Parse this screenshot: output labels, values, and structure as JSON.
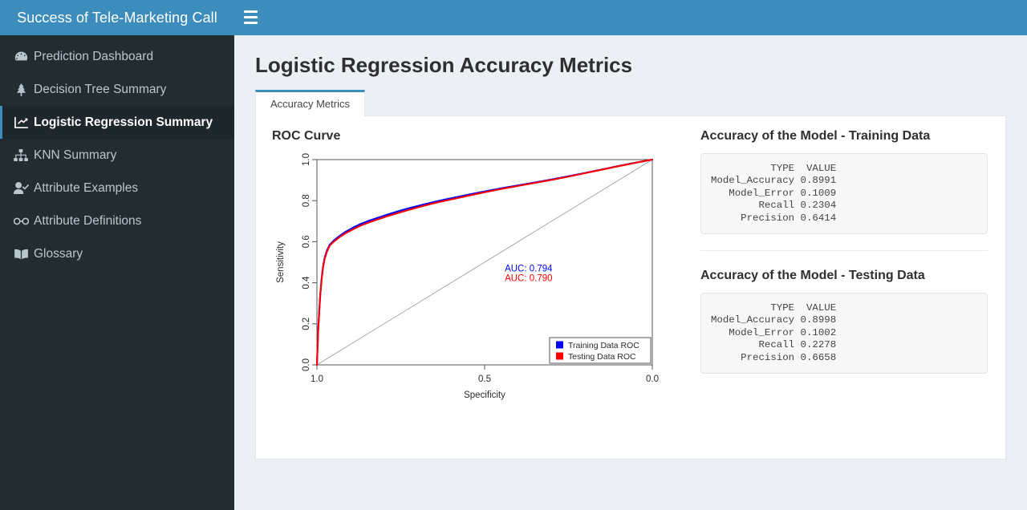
{
  "brand": {
    "title": "Success of Tele-Marketing Call"
  },
  "topbar": {
    "menu_icon": "hamburger-icon"
  },
  "sidebar": {
    "items": [
      {
        "label": "Prediction Dashboard",
        "icon": "tachometer-icon",
        "active": false
      },
      {
        "label": "Decision Tree Summary",
        "icon": "tree-icon",
        "active": false
      },
      {
        "label": "Logistic Regression Summary",
        "icon": "chart-line-icon",
        "active": true
      },
      {
        "label": "KNN Summary",
        "icon": "sitemap-icon",
        "active": false
      },
      {
        "label": "Attribute Examples",
        "icon": "user-check-icon",
        "active": false
      },
      {
        "label": "Attribute Definitions",
        "icon": "glasses-icon",
        "active": false
      },
      {
        "label": "Glossary",
        "icon": "book-icon",
        "active": false
      }
    ]
  },
  "page": {
    "title": "Logistic Regression Accuracy Metrics"
  },
  "tabs": [
    {
      "label": "Accuracy Metrics",
      "active": true
    }
  ],
  "plot_panel": {
    "title": "ROC Curve"
  },
  "training": {
    "title": "Accuracy of the Model - Training Data",
    "text": "          TYPE  VALUE\nModel_Accuracy 0.8991\n   Model_Error 0.1009\n        Recall 0.2304\n     Precision 0.6414"
  },
  "testing": {
    "title": "Accuracy of the Model - Testing Data",
    "text": "          TYPE  VALUE\nModel_Accuracy 0.8998\n   Model_Error 0.1002\n        Recall 0.2278\n     Precision 0.6658"
  },
  "colors": {
    "brand_blue": "#3c8dbc",
    "sidebar_dark": "#222d32",
    "page_bg": "#ecf0f5",
    "training_roc": "#0000ff",
    "testing_roc": "#ff0000",
    "diagonal": "#999999"
  },
  "chart_data": {
    "type": "line",
    "title": "ROC Curve",
    "xlabel": "Specificity",
    "ylabel": "Sensitivity",
    "xlim": [
      1.0,
      0.0
    ],
    "ylim": [
      0.0,
      1.0
    ],
    "x_ticks": [
      "1.0",
      "0.5",
      "0.0"
    ],
    "x_tick_values": [
      1.0,
      0.5,
      0.0
    ],
    "y_ticks": [
      "0.0",
      "0.2",
      "0.4",
      "0.6",
      "0.8",
      "1.0"
    ],
    "y_tick_values": [
      0.0,
      0.2,
      0.4,
      0.6,
      0.8,
      1.0
    ],
    "grid": false,
    "x_axis_reversed": true,
    "legend_position": "bottom-right",
    "annotations": [
      {
        "text": "AUC: 0.794",
        "color": "#0000ff",
        "x": 0.44,
        "y": 0.455
      },
      {
        "text": "AUC: 0.790",
        "color": "#ff0000",
        "x": 0.44,
        "y": 0.408
      }
    ],
    "series": [
      {
        "name": "Training Data ROC",
        "color": "#0000ff",
        "auc": 0.794,
        "points": [
          [
            1.0,
            0.0
          ],
          [
            0.998,
            0.09
          ],
          [
            0.996,
            0.175
          ],
          [
            0.993,
            0.265
          ],
          [
            0.99,
            0.345
          ],
          [
            0.986,
            0.42
          ],
          [
            0.982,
            0.478
          ],
          [
            0.977,
            0.522
          ],
          [
            0.97,
            0.558
          ],
          [
            0.962,
            0.585
          ],
          [
            0.95,
            0.605
          ],
          [
            0.935,
            0.625
          ],
          [
            0.915,
            0.648
          ],
          [
            0.893,
            0.668
          ],
          [
            0.87,
            0.686
          ],
          [
            0.845,
            0.702
          ],
          [
            0.818,
            0.717
          ],
          [
            0.79,
            0.732
          ],
          [
            0.76,
            0.747
          ],
          [
            0.728,
            0.762
          ],
          [
            0.695,
            0.776
          ],
          [
            0.66,
            0.79
          ],
          [
            0.622,
            0.804
          ],
          [
            0.582,
            0.818
          ],
          [
            0.54,
            0.832
          ],
          [
            0.496,
            0.846
          ],
          [
            0.45,
            0.86
          ],
          [
            0.402,
            0.874
          ],
          [
            0.352,
            0.888
          ],
          [
            0.3,
            0.903
          ],
          [
            0.25,
            0.919
          ],
          [
            0.2,
            0.935
          ],
          [
            0.15,
            0.952
          ],
          [
            0.1,
            0.969
          ],
          [
            0.06,
            0.982
          ],
          [
            0.03,
            0.991
          ],
          [
            0.01,
            0.997
          ],
          [
            0.0,
            1.0
          ]
        ]
      },
      {
        "name": "Testing Data ROC",
        "color": "#ff0000",
        "auc": 0.79,
        "points": [
          [
            1.0,
            0.0
          ],
          [
            0.998,
            0.088
          ],
          [
            0.996,
            0.172
          ],
          [
            0.993,
            0.26
          ],
          [
            0.99,
            0.34
          ],
          [
            0.986,
            0.414
          ],
          [
            0.982,
            0.472
          ],
          [
            0.977,
            0.516
          ],
          [
            0.97,
            0.552
          ],
          [
            0.962,
            0.58
          ],
          [
            0.95,
            0.6
          ],
          [
            0.935,
            0.619
          ],
          [
            0.915,
            0.641
          ],
          [
            0.893,
            0.66
          ],
          [
            0.87,
            0.678
          ],
          [
            0.845,
            0.694
          ],
          [
            0.818,
            0.709
          ],
          [
            0.79,
            0.724
          ],
          [
            0.76,
            0.739
          ],
          [
            0.728,
            0.754
          ],
          [
            0.695,
            0.769
          ],
          [
            0.66,
            0.784
          ],
          [
            0.622,
            0.798
          ],
          [
            0.582,
            0.812
          ],
          [
            0.54,
            0.827
          ],
          [
            0.496,
            0.842
          ],
          [
            0.45,
            0.857
          ],
          [
            0.402,
            0.871
          ],
          [
            0.352,
            0.886
          ],
          [
            0.3,
            0.901
          ],
          [
            0.25,
            0.917
          ],
          [
            0.2,
            0.934
          ],
          [
            0.15,
            0.951
          ],
          [
            0.1,
            0.968
          ],
          [
            0.06,
            0.981
          ],
          [
            0.03,
            0.991
          ],
          [
            0.01,
            0.997
          ],
          [
            0.0,
            1.0
          ]
        ]
      }
    ],
    "reference_line": {
      "name": "chance-diagonal",
      "from": [
        1.0,
        0.0
      ],
      "to": [
        0.0,
        1.0
      ],
      "color": "#999999"
    }
  }
}
